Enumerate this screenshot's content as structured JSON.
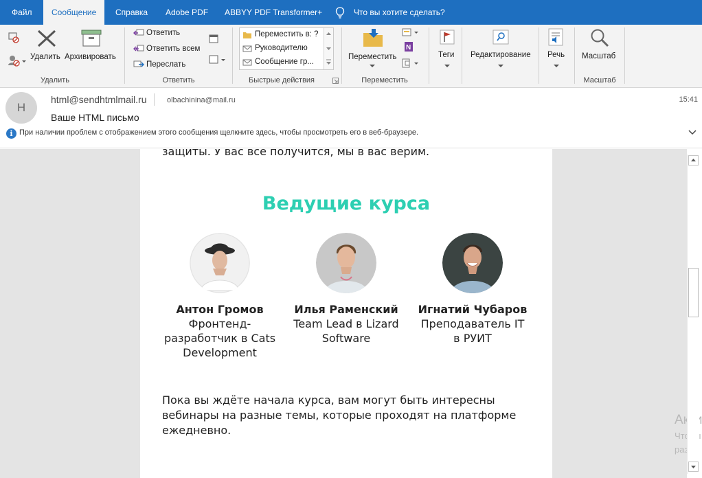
{
  "menu": {
    "tabs": [
      "Файл",
      "Сообщение",
      "Справка",
      "Adobe PDF",
      "ABBYY PDF Transformer+",
      "Что вы хотите сделать?"
    ],
    "active_tab": "Сообщение"
  },
  "ribbon": {
    "delete_group": {
      "delete_label": "Удалить",
      "archive_label": "Архивировать",
      "group_label": "Удалить"
    },
    "respond_group": {
      "reply": "Ответить",
      "reply_all": "Ответить всем",
      "forward": "Переслать",
      "group_label": "Ответить"
    },
    "quick_steps": {
      "items": [
        "Переместить в: ?",
        "Руководителю",
        "Сообщение гр..."
      ],
      "group_label": "Быстрые действия"
    },
    "move_group": {
      "move_label": "Переместить",
      "group_label": "Переместить"
    },
    "tags": {
      "label": "Теги"
    },
    "editing": {
      "label": "Редактирование"
    },
    "speech": {
      "label": "Речь"
    },
    "zoom_group": {
      "zoom_label": "Масштаб",
      "group_label": "Масштаб"
    }
  },
  "message": {
    "avatar_letter": "H",
    "from": "html@sendhtmlmail.ru",
    "to": "olbachinina@mail.ru",
    "time": "15:41",
    "subject": "Ваше HTML письмо",
    "info_bar": "При наличии проблем с отображением этого сообщения щелкните здесь, чтобы просмотреть его в веб-браузере."
  },
  "email_body": {
    "cut_top_text": "защиты. У вас все получится, мы в вас верим.",
    "section_title": "Ведущие курса",
    "instructors": [
      {
        "name": "Антон Громов",
        "role_lines": [
          "Фронтенд-",
          "разработчик в Cats",
          "Development"
        ]
      },
      {
        "name": "Илья Раменский",
        "role_lines": [
          "Team Lead в Lizard",
          "Software"
        ]
      },
      {
        "name": "Игнатий Чубаров",
        "role_lines": [
          "Преподаватель IT",
          "в РУИТ"
        ]
      }
    ],
    "paragraph_lines": [
      "Пока вы ждёте начала курса, вам могут быть интересны",
      "вебинары на разные темы, которые проходят на платформе",
      "ежедневно."
    ]
  },
  "watermark": {
    "line1": "Акти",
    "line2": "Чтобы",
    "line3": "разде"
  },
  "colors": {
    "menubar": "#1e6fc0",
    "accent_title": "#2dcfb2"
  }
}
